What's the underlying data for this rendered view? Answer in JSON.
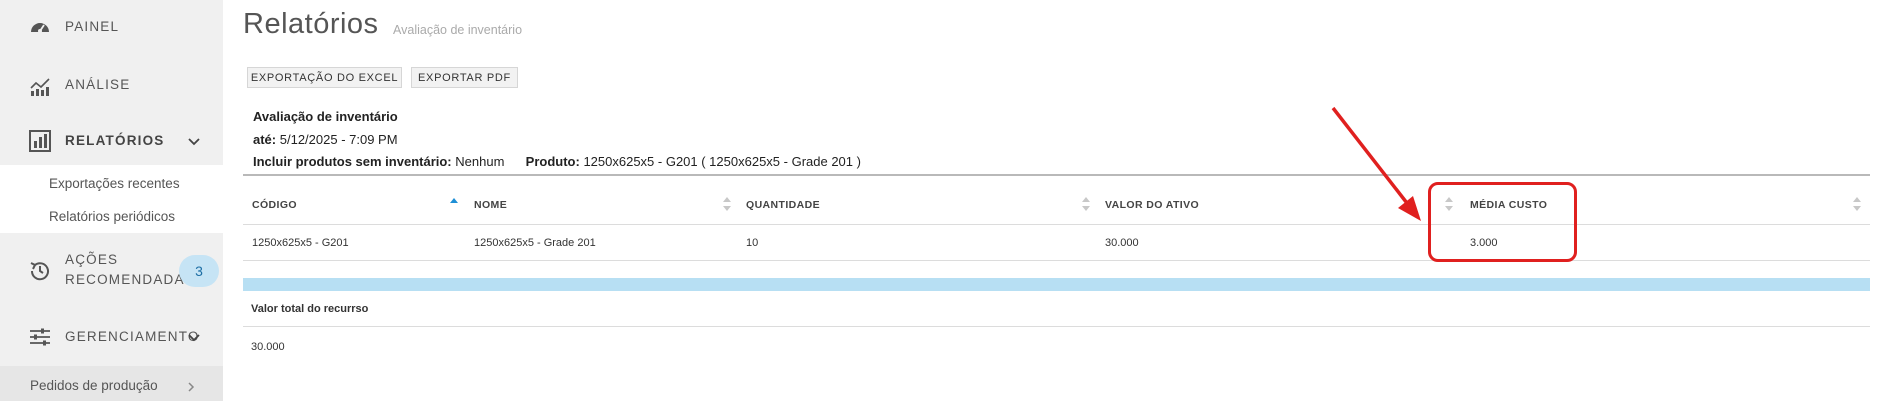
{
  "sidebar": {
    "items": [
      {
        "label": "PAINEL",
        "icon": "dashboard-gauge-icon"
      },
      {
        "label": "ANÁLISE",
        "icon": "analytics-chart-icon"
      },
      {
        "label": "RELATÓRIOS",
        "icon": "reports-bar-icon",
        "expanded": true
      },
      {
        "label_line1": "AÇÕES",
        "label_line2": "RECOMENDADAS",
        "icon": "history-clock-icon",
        "badge": "3"
      },
      {
        "label": "GERENCIAMENTO",
        "icon": "sliders-icon"
      }
    ],
    "sub_items": [
      "Exportações recentes",
      "Relatórios periódicos"
    ],
    "bottom_item": "Pedidos de produção"
  },
  "header": {
    "title": "Relatórios",
    "subtitle": "Avaliação de inventário"
  },
  "toolbar": {
    "excel_label": "EXPORTAÇÃO DO EXCEL",
    "pdf_label": "EXPORTAR PDF"
  },
  "report": {
    "name": "Avaliação de inventário",
    "until_label": "até:",
    "until_value": "5/12/2025 - 7:09 PM",
    "include_label": "Incluir produtos sem inventário:",
    "include_value": "Nenhum",
    "product_label": "Produto:",
    "product_value": "1250x625x5 - G201 ( 1250x625x5 - Grade 201 )"
  },
  "table": {
    "columns": [
      "CÓDIGO",
      "NOME",
      "QUANTIDADE",
      "VALOR DO ATIVO",
      "MÉDIA CUSTO"
    ],
    "rows": [
      [
        "1250x625x5 - G201",
        "1250x625x5 - Grade 201",
        "10",
        "30.000",
        "3.000"
      ]
    ]
  },
  "totals": {
    "label": "Valor total do recurrso",
    "value": "30.000"
  },
  "colors": {
    "sidebar_bg": "#f0f0f0",
    "highlight": "#e0201f",
    "band": "#b7dff3",
    "badge_bg": "#c6e4f5",
    "sort_active": "#1e8fd6"
  }
}
